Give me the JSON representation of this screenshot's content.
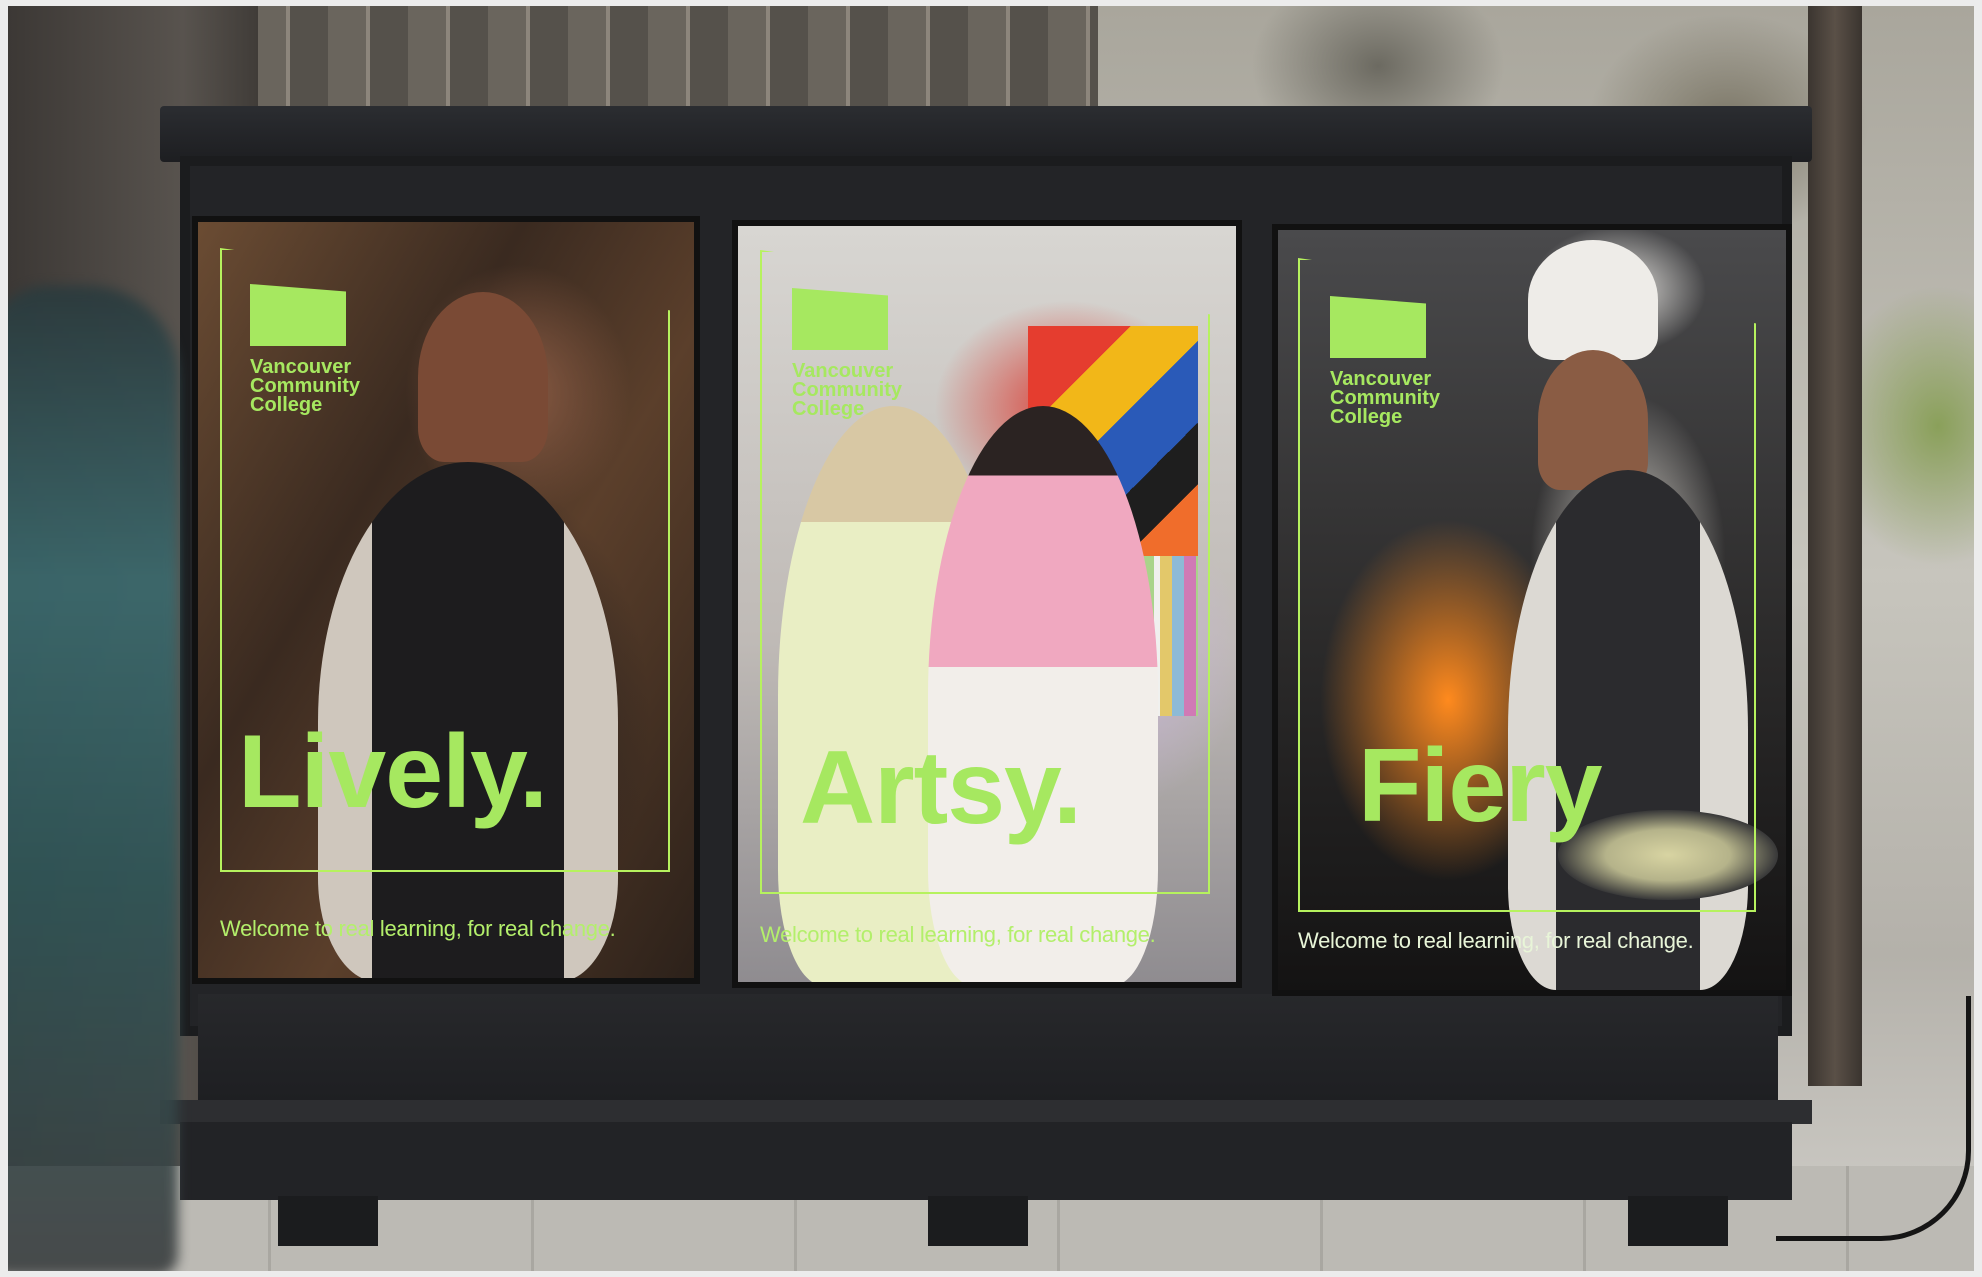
{
  "scene": "Bus-shelter billboard on a city sidewalk with three posters",
  "brand": {
    "name": "Vancouver Community College",
    "accent_color": "#a6e860"
  },
  "posters": [
    {
      "logo_text": "Vancouver\nCommunity\nCollege",
      "headline": "Lively.",
      "tagline": "Welcome to real learning, for real change."
    },
    {
      "logo_text": "Vancouver\nCommunity\nCollege",
      "headline": "Artsy.",
      "tagline": "Welcome to real learning, for real change."
    },
    {
      "logo_text": "Vancouver\nCommunity\nCollege",
      "headline": "Fiery",
      "tagline": "Welcome to real learning, for real change."
    }
  ]
}
